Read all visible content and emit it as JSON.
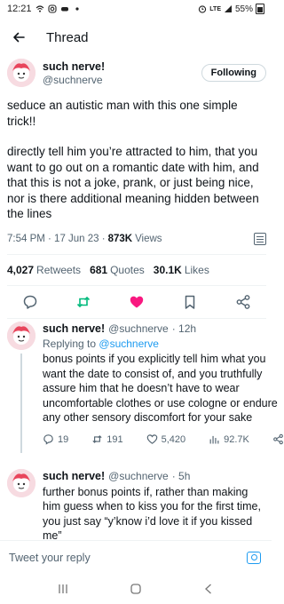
{
  "status_bar": {
    "time": "12:21",
    "battery": "55%",
    "network": "LTE"
  },
  "header": {
    "title": "Thread",
    "back_icon": "arrow-left-icon"
  },
  "main_tweet": {
    "display_name": "such nerve!",
    "handle": "@suchnerve",
    "follow_label": "Following",
    "paragraphs": [
      "seduce an autistic man with this one simple trick!!",
      "directly tell him you’re attracted to him, that you want to go out on a romantic date with him, and that this is not a joke, prank, or just being nice, nor is there additional meaning hidden between the lines"
    ],
    "time": "7:54 PM · 17 Jun 23 · ",
    "views_count": "873K",
    "views_label": "Views",
    "stats": {
      "retweets_count": "4,027",
      "retweets_label": "Retweets",
      "quotes_count": "681",
      "quotes_label": "Quotes",
      "likes_count": "30.1K",
      "likes_label": "Likes"
    },
    "actions": [
      "reply-icon",
      "retweet-icon",
      "like-icon",
      "bookmark-icon",
      "share-icon"
    ],
    "like_color": "#f91880",
    "retweet_color": "#00ba7c"
  },
  "replies": [
    {
      "display_name": "such nerve!",
      "handle": "@suchnerve",
      "time": "· 12h",
      "replying_prefix": "Replying to",
      "replying_mention": "@suchnerve",
      "text": "bonus points if you explicitly tell him what you want the date to consist of, and you truthfully assure him that he doesn’t have to wear uncomfortable clothes or use cologne or endure any other sensory discomfort for your sake",
      "replies": "19",
      "retweets": "191",
      "likes": "5,420",
      "views": "92.7K"
    },
    {
      "display_name": "such nerve!",
      "handle": "@suchnerve",
      "time": "· 5h",
      "text": "further bonus points if, rather than making him guess when to kiss you for the first time, you just say “y’know i’d love it if you kissed me”"
    }
  ],
  "composer": {
    "placeholder": "Tweet your reply"
  },
  "colors": {
    "accent": "#1d9bf0",
    "text": "#0f1419",
    "muted": "#536471"
  }
}
